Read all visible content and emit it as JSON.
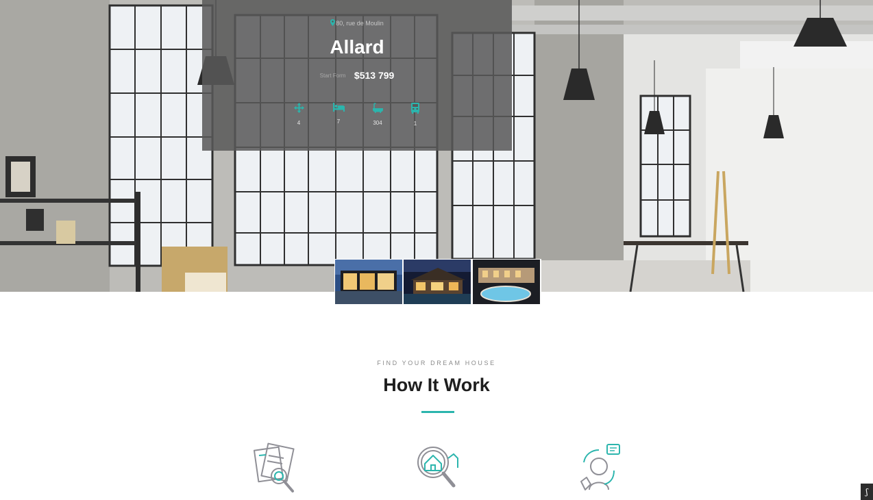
{
  "property": {
    "address": "80, rue de Moulin",
    "title": "Allard",
    "price_label": "Start Form",
    "price": "$513 799",
    "features": [
      {
        "icon": "area-arrows-icon",
        "value": "4"
      },
      {
        "icon": "bed-icon",
        "value": "7"
      },
      {
        "icon": "bathtub-icon",
        "value": "304"
      },
      {
        "icon": "garage-icon",
        "value": "1"
      }
    ],
    "thumbnails": [
      "modern-house-thumbnail",
      "villa-night-thumbnail",
      "pool-villa-thumbnail"
    ]
  },
  "how_it_works": {
    "eyebrow": "FIND YOUR DREAM HOUSE",
    "title": "How It Work",
    "steps": [
      {
        "icon": "documents-search-icon"
      },
      {
        "icon": "house-search-icon"
      },
      {
        "icon": "support-agent-icon"
      }
    ]
  },
  "corner_button": {
    "label": "ʃ"
  },
  "colors": {
    "accent": "#2bb5ad",
    "card_overlay": "#585858",
    "heading": "#1e1e1e"
  }
}
